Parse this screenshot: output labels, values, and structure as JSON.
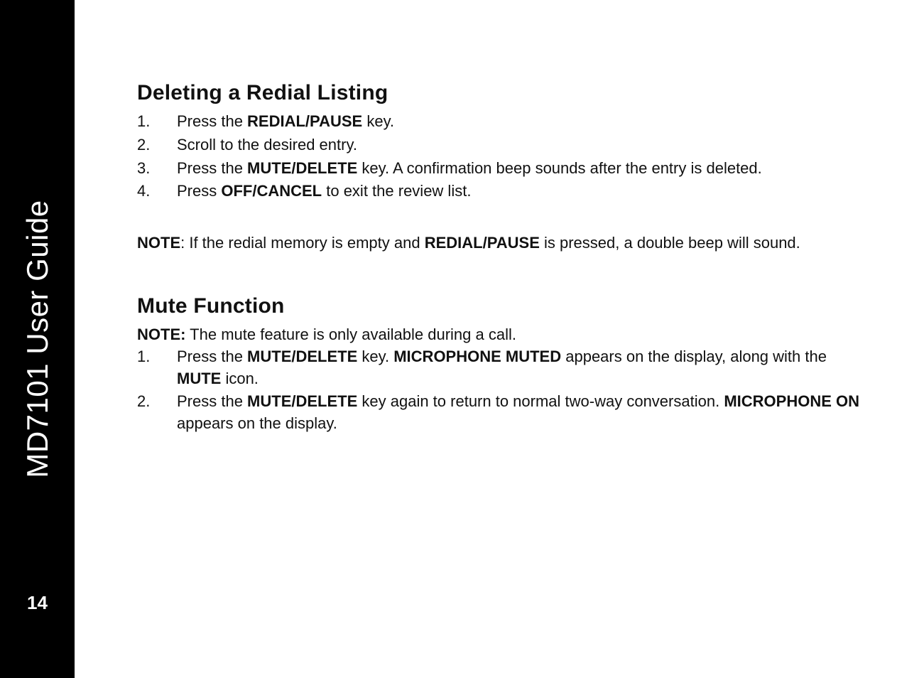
{
  "sidebar": {
    "title": "MD7101 User Guide",
    "page_number": "14"
  },
  "section1": {
    "heading": "Deleting a Redial Listing",
    "items": [
      {
        "n": "1.",
        "pre": "Press the ",
        "b1": "REDIAL/PAUSE",
        "post": " key."
      },
      {
        "n": "2.",
        "pre": "Scroll to the desired entry.",
        "b1": "",
        "post": ""
      },
      {
        "n": "3.",
        "pre": "Press the ",
        "b1": "MUTE/DELETE",
        "post": " key. A confirmation beep sounds after the entry is deleted."
      },
      {
        "n": "4.",
        "pre": "Press ",
        "b1": "OFF/CANCEL",
        "post": " to exit the review list."
      }
    ],
    "note_label": "NOTE",
    "note_pre": ": If the redial memory is empty and ",
    "note_b": "REDIAL/PAUSE",
    "note_post": " is pressed, a double beep will sound."
  },
  "section2": {
    "heading": "Mute Function",
    "note_label": "NOTE:",
    "note_text": " The mute feature is only available during a call.",
    "items": [
      {
        "n": "1.",
        "pre": "Press the ",
        "b1": "MUTE/DELETE",
        "mid1": " key. ",
        "b2": "MICROPHONE MUTED",
        "mid2": " appears on the display, along with the ",
        "b3": "MUTE",
        "post": " icon."
      },
      {
        "n": "2.",
        "pre": "Press the ",
        "b1": "MUTE/DELETE",
        "mid1": " key again to return to normal two-way conversation. ",
        "b2": "MICROPHONE ON",
        "mid2": " appears on the display.",
        "b3": "",
        "post": ""
      }
    ]
  }
}
